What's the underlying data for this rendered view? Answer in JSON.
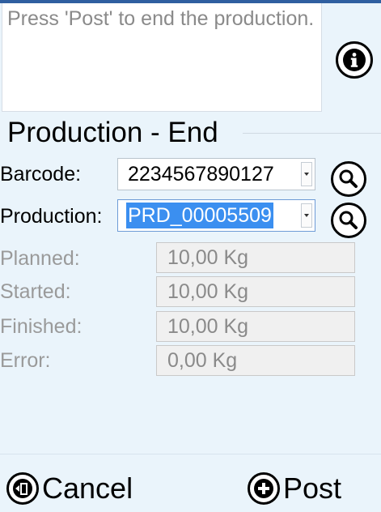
{
  "message": {
    "text": "Press 'Post' to end the production."
  },
  "icons": {
    "info": "info-icon",
    "search": "magnifier-icon",
    "cancel": "exit-door-icon",
    "post": "plus-circle-icon"
  },
  "page": {
    "title": "Production - End"
  },
  "form": {
    "barcode_label": "Barcode:",
    "barcode_value": "2234567890127",
    "production_label": "Production:",
    "production_value": "PRD_00005509",
    "planned_label": "Planned:",
    "planned_value": "10,00 Kg",
    "started_label": "Started:",
    "started_value": "10,00 Kg",
    "finished_label": "Finished:",
    "finished_value": "10,00 Kg",
    "error_label": "Error:",
    "error_value": "0,00 Kg"
  },
  "footer": {
    "cancel_label": "Cancel",
    "post_label": "Post"
  },
  "colors": {
    "background": "#eaf4fb",
    "selection": "#3b8ff0",
    "accent_strip": "#2f5fa0"
  }
}
